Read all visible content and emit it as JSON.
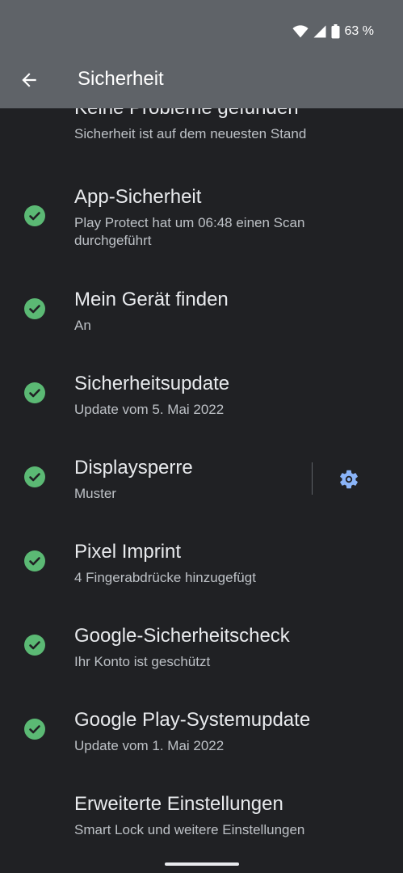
{
  "status_bar": {
    "battery": "63 %"
  },
  "header": {
    "title": "Sicherheit"
  },
  "summary": {
    "title": "Keine Probleme gefunden",
    "subtitle": "Sicherheit ist auf dem neuesten Stand"
  },
  "items": [
    {
      "label": "App-Sicherheit",
      "sub": "Play Protect hat um 06:48 einen Scan durchgeführt"
    },
    {
      "label": "Mein Gerät finden",
      "sub": "An"
    },
    {
      "label": "Sicherheitsupdate",
      "sub": "Update vom 5. Mai 2022"
    },
    {
      "label": "Displaysperre",
      "sub": "Muster"
    },
    {
      "label": "Pixel Imprint",
      "sub": "4 Fingerabdrücke hinzugefügt"
    },
    {
      "label": "Google-Sicherheitscheck",
      "sub": "Ihr Konto ist geschützt"
    },
    {
      "label": "Google Play-Systemupdate",
      "sub": "Update vom 1. Mai 2022"
    },
    {
      "label": "Erweiterte Einstellungen",
      "sub": "Smart Lock und weitere Einstellungen"
    }
  ],
  "colors": {
    "check": "#5bb974",
    "background": "#202124",
    "header": "#5f6368"
  }
}
